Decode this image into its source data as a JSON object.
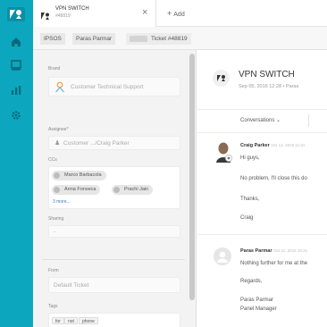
{
  "tabs": [
    {
      "title": "VPN SWITCH",
      "id": "#48819"
    }
  ],
  "add_tab_label": "Add",
  "breadcrumb": [
    "IPSOS",
    "Paras Parmar",
    "Ticket #48819"
  ],
  "sidebar": {
    "brand_label": "Brand",
    "brand_value": "Customer Technical Support",
    "assignee_label": "Assignee*",
    "assignee_value": "Customer .../Craig Parker",
    "ccs_label": "CCs",
    "ccs": [
      "Marco Barbacola",
      "Anna Fonseca",
      "Prachi Jain"
    ],
    "ccs_more": "3 more...",
    "sharing_label": "Sharing",
    "sharing_value": "-",
    "form_label": "Form",
    "form_value": "Default Ticket",
    "tags_label": "Tags",
    "tags": [
      "for",
      "not",
      "phone"
    ]
  },
  "ticket": {
    "title": "VPN SWITCH",
    "meta": "Sep 05, 2016 12:28",
    "meta_via": "Paras",
    "conversations_label": "Conversations"
  },
  "messages": [
    {
      "author": "Craig Parker",
      "time": "Oct 12, 2016 11:31",
      "lines": [
        "Hi guys,",
        "No problem, I'll close this do",
        "Thanks,",
        "Craig"
      ]
    },
    {
      "author": "Paras Parmar",
      "time": "Oct 11, 2016 16:21",
      "lines": [
        "Nothing further for me at the",
        "Regards,",
        "Paras Parmar",
        "Panel Manager"
      ]
    }
  ],
  "colors": {
    "rail": "#0da6bf",
    "sidebar": "#f3f3f3",
    "breadcrumb": "#f7f7f7"
  }
}
